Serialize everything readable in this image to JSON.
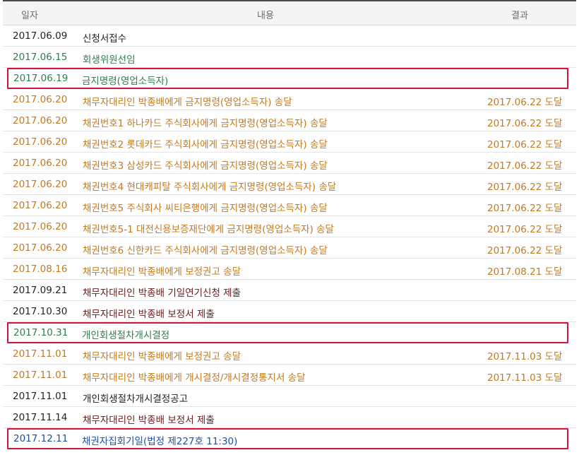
{
  "colors": {
    "black": "#222222",
    "green": "#2e7d4f",
    "orange": "#c27a1f",
    "dark_red": "#6b1a1a",
    "blue": "#1f4fa0",
    "highlight_border": "#d4143c"
  },
  "header": {
    "date": "일자",
    "content": "내용",
    "result": "결과"
  },
  "rows": [
    {
      "date": "2017.06.09",
      "content": "신청서접수",
      "result": "",
      "color": "black",
      "highlight": false
    },
    {
      "date": "2017.06.15",
      "content": "회생위원선임",
      "result": "",
      "color": "green",
      "highlight": false
    },
    {
      "date": "2017.06.19",
      "content": "금지명령(영업소득자)",
      "result": "",
      "color": "green",
      "highlight": true
    },
    {
      "date": "2017.06.20",
      "content": "채무자대리인 박종배에게 금지명령(영업소득자) 송달",
      "result": "2017.06.22 도달",
      "color": "orange",
      "highlight": false
    },
    {
      "date": "2017.06.20",
      "content": "채권번호1 하나카드 주식회사에게 금지명령(영업소득자) 송달",
      "result": "2017.06.22 도달",
      "color": "orange",
      "highlight": false
    },
    {
      "date": "2017.06.20",
      "content": "채권번호2 롯데카드 주식회사에게 금지명령(영업소득자) 송달",
      "result": "2017.06.22 도달",
      "color": "orange",
      "highlight": false
    },
    {
      "date": "2017.06.20",
      "content": "채권번호3 삼성카드 주식회사에게 금지명령(영업소득자) 송달",
      "result": "2017.06.22 도달",
      "color": "orange",
      "highlight": false
    },
    {
      "date": "2017.06.20",
      "content": "채권번호4 현대캐피탈 주식회사에게 금지명령(영업소득자) 송달",
      "result": "2017.06.22 도달",
      "color": "orange",
      "highlight": false
    },
    {
      "date": "2017.06.20",
      "content": "채권번호5 주식회사 씨티은행에게 금지명령(영업소득자) 송달",
      "result": "2017.06.22 도달",
      "color": "orange",
      "highlight": false
    },
    {
      "date": "2017.06.20",
      "content": "채권번호5-1 대전신용보증재단에게 금지명령(영업소득자) 송달",
      "result": "2017.06.22 도달",
      "color": "orange",
      "highlight": false
    },
    {
      "date": "2017.06.20",
      "content": "채권번호6 신한카드 주식회사에게 금지명령(영업소득자) 송달",
      "result": "2017.06.22 도달",
      "color": "orange",
      "highlight": false
    },
    {
      "date": "2017.08.16",
      "content": "채무자대리인 박종배에게 보정권고 송달",
      "result": "2017.08.21 도달",
      "color": "orange",
      "highlight": false
    },
    {
      "date": "2017.09.21",
      "content": "채무자대리인 박종배 기일연기신청 제출",
      "result": "",
      "color": "dark_red",
      "highlight": false
    },
    {
      "date": "2017.10.30",
      "content": "채무자대리인 박종배 보정서 제출",
      "result": "",
      "color": "dark_red",
      "highlight": false
    },
    {
      "date": "2017.10.31",
      "content": "개인회생절차개시결정",
      "result": "",
      "color": "green",
      "highlight": true
    },
    {
      "date": "2017.11.01",
      "content": "채무자대리인 박종배에게 보정권고 송달",
      "result": "2017.11.03 도달",
      "color": "orange",
      "highlight": false
    },
    {
      "date": "2017.11.01",
      "content": "채무자대리인 박종배에게 개시결정/개시결정통지서 송달",
      "result": "2017.11.03 도달",
      "color": "orange",
      "highlight": false
    },
    {
      "date": "2017.11.01",
      "content": "개인회생절차개시결정공고",
      "result": "",
      "color": "black",
      "highlight": false
    },
    {
      "date": "2017.11.14",
      "content": "채무자대리인 박종배 보정서 제출",
      "result": "",
      "color": "dark_red",
      "highlight": false
    },
    {
      "date": "2017.12.11",
      "content": "채권자집회기일(법정 제227호 11:30)",
      "result": "",
      "color": "blue",
      "highlight": true
    }
  ]
}
